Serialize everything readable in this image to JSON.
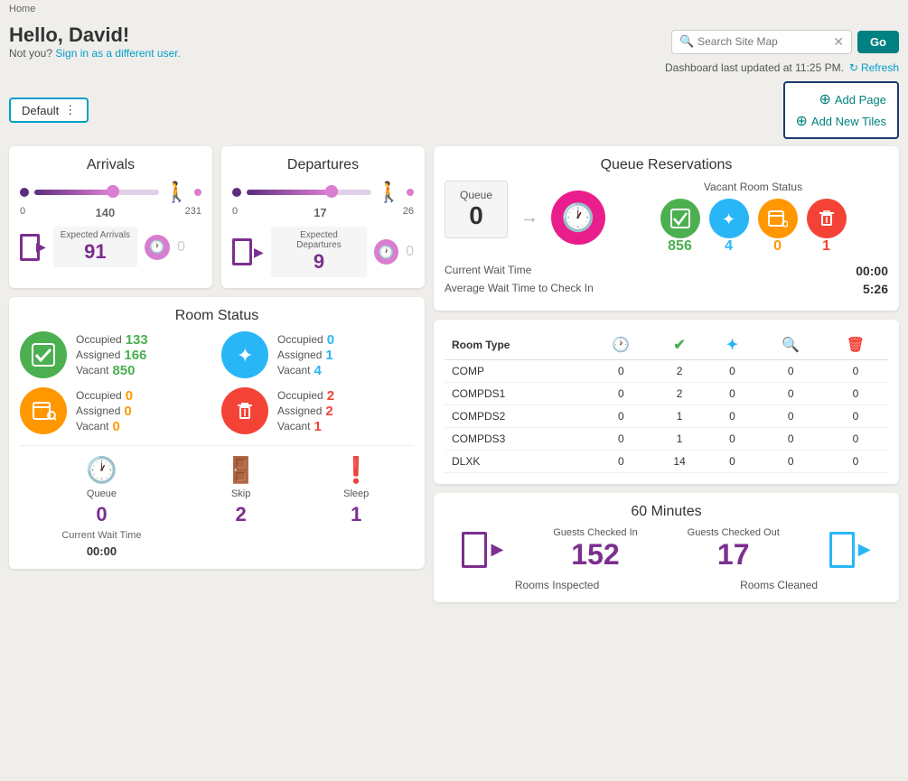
{
  "breadcrumb": "Home",
  "greeting": "Hello, David!",
  "not_you": "Not you?",
  "sign_in_link": "Sign in as a different user.",
  "search": {
    "placeholder": "Search Site Map",
    "value": ""
  },
  "go_button": "Go",
  "dashboard_info": "Dashboard last updated at 11:25 PM.",
  "refresh_label": "Refresh",
  "default_label": "Default",
  "add_page_label": "Add Page",
  "add_tiles_label": "Add New Tiles",
  "arrivals": {
    "title": "Arrivals",
    "range_start": "0",
    "range_mid": "140",
    "range_end": "231",
    "progress_pct": 60,
    "expected_label": "Expected Arrivals",
    "expected_num": "91",
    "clock_val": "0"
  },
  "departures": {
    "title": "Departures",
    "range_start": "0",
    "range_mid": "17",
    "range_end": "26",
    "progress_pct": 65,
    "expected_label": "Expected Departures",
    "expected_num": "9",
    "clock_val": "0"
  },
  "room_status": {
    "title": "Room Status",
    "items": [
      {
        "icon": "check",
        "color": "green",
        "occupied": "133",
        "assigned": "166",
        "vacant": "850"
      },
      {
        "icon": "sparkle",
        "color": "blue",
        "occupied": "0",
        "assigned": "1",
        "vacant": "4"
      },
      {
        "icon": "search-trash",
        "color": "orange",
        "occupied": "0",
        "assigned": "0",
        "vacant": "0"
      },
      {
        "icon": "trash",
        "color": "red",
        "occupied": "2",
        "assigned": "2",
        "vacant": "1"
      }
    ],
    "bottom": [
      {
        "label": "Queue",
        "num": "0",
        "icon": "clock-pink"
      },
      {
        "label": "Skip",
        "num": "2",
        "icon": "skip-maroon"
      },
      {
        "label": "Sleep",
        "num": "1",
        "icon": "sleep-red"
      }
    ],
    "current_wait_label": "Current Wait Time",
    "current_wait_val": "00:00"
  },
  "queue_reservations": {
    "title": "Queue Reservations",
    "queue_label": "Queue",
    "queue_num": "0",
    "vacant_title": "Vacant Room Status",
    "vacant_items": [
      {
        "color": "green",
        "count": "856",
        "icon": "check"
      },
      {
        "color": "blue",
        "count": "4",
        "icon": "sparkle"
      },
      {
        "color": "orange",
        "count": "0",
        "icon": "search-trash"
      },
      {
        "color": "red",
        "count": "1",
        "icon": "trash"
      }
    ],
    "wait_time_label": "Current Wait Time",
    "wait_time_val": "00:00",
    "avg_wait_label": "Average Wait Time to Check In",
    "avg_wait_val": "5:26",
    "table": {
      "headers": [
        "Room Type",
        "clock",
        "check",
        "sparkle",
        "search-trash",
        "trash"
      ],
      "rows": [
        [
          "COMP",
          "0",
          "2",
          "0",
          "0",
          "0"
        ],
        [
          "COMPDS1",
          "0",
          "2",
          "0",
          "0",
          "0"
        ],
        [
          "COMPDS2",
          "0",
          "1",
          "0",
          "0",
          "0"
        ],
        [
          "COMPDS3",
          "0",
          "1",
          "0",
          "0",
          "0"
        ],
        [
          "DLXK",
          "0",
          "14",
          "0",
          "0",
          "0"
        ]
      ]
    }
  },
  "sixty_minutes": {
    "title": "60 Minutes",
    "checked_in_label": "Guests Checked In",
    "checked_in_num": "152",
    "checked_out_label": "Guests Checked Out",
    "checked_out_num": "17",
    "inspected_label": "Rooms Inspected",
    "cleaned_label": "Rooms Cleaned"
  },
  "colors": {
    "green": "#4caf50",
    "blue": "#29b6f6",
    "orange": "#ff9800",
    "red": "#f44336",
    "purple": "#7b2f8e",
    "pink": "#e91e8c",
    "teal": "#008080"
  }
}
